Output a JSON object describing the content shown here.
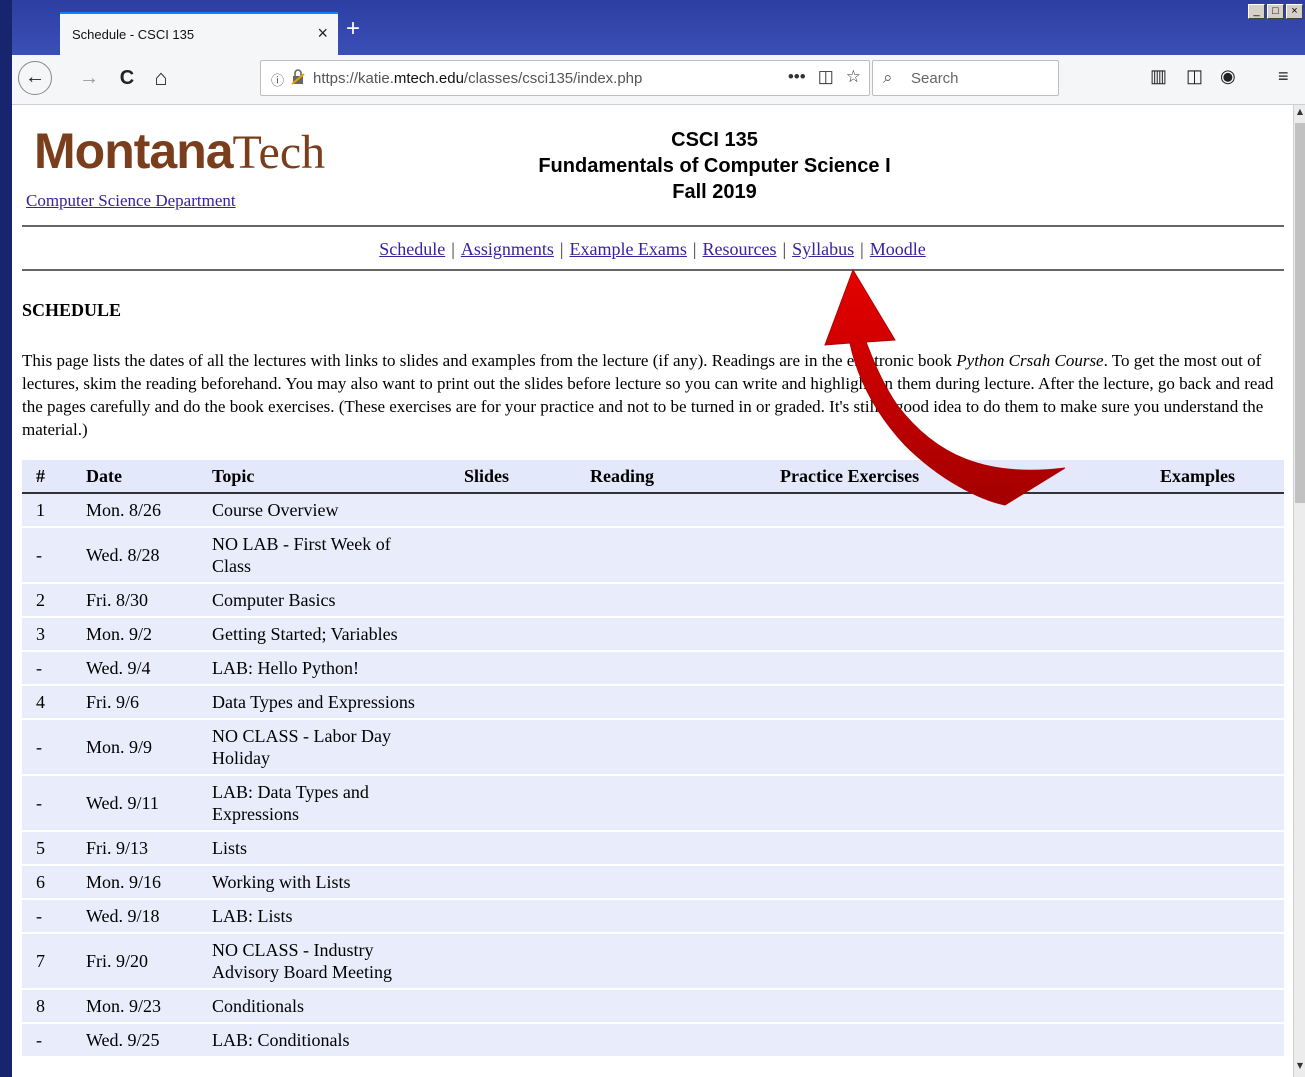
{
  "browser": {
    "tab_title": "Schedule - CSCI 135",
    "tab_close": "×",
    "new_tab": "+",
    "window_controls": [
      "_",
      "□",
      "×"
    ],
    "url_host_prefix": "https://katie.",
    "url_host": "mtech.edu",
    "url_path": "/classes/csci135/index.php",
    "search_placeholder": "Search",
    "nav": {
      "back": "←",
      "forward": "→",
      "reload": "C",
      "home": "⌂"
    },
    "url_actions": [
      "•••",
      "◫",
      "☆"
    ]
  },
  "header": {
    "logo_bold": "Montana",
    "logo_light": "Tech",
    "dept_link": "Computer Science Department",
    "course_code": "CSCI 135",
    "course_name": "Fundamentals of Computer Science I",
    "term": "Fall 2019"
  },
  "nav_links": [
    "Schedule",
    "Assignments",
    "Example Exams",
    "Resources",
    "Syllabus",
    "Moodle"
  ],
  "nav_separator": "|",
  "content": {
    "heading": "SCHEDULE",
    "intro_part1": "This page lists the dates of all the lectures with links to slides and examples from the lecture (if any). Readings are in the electronic book ",
    "intro_book": "Python Crsah Course",
    "intro_part2": ". To get the most out of lectures, skim the reading beforehand. You may also want to print out the slides before lecture so you can write and highlight on them during lecture. After the lecture, go back and read the pages carefully and do the book exercises. (These exercises are for your practice and not to be turned in or graded. It's still a good idea to do them to make sure you understand the material.)"
  },
  "table": {
    "columns": [
      "#",
      "Date",
      "Topic",
      "Slides",
      "Reading",
      "Practice Exercises",
      "Examples"
    ],
    "rows": [
      {
        "num": "1",
        "date": "Mon. 8/26",
        "topic": "Course Overview"
      },
      {
        "num": "-",
        "date": "Wed. 8/28",
        "topic": "NO LAB - First Week of Class"
      },
      {
        "num": "2",
        "date": "Fri. 8/30",
        "topic": "Computer Basics"
      },
      {
        "num": "3",
        "date": "Mon. 9/2",
        "topic": "Getting Started; Variables"
      },
      {
        "num": "-",
        "date": "Wed. 9/4",
        "topic": "LAB: Hello Python!"
      },
      {
        "num": "4",
        "date": "Fri. 9/6",
        "topic": "Data Types and Expressions"
      },
      {
        "num": "-",
        "date": "Mon. 9/9",
        "topic": "NO CLASS - Labor Day Holiday"
      },
      {
        "num": "-",
        "date": "Wed. 9/11",
        "topic": "LAB: Data Types and Expressions"
      },
      {
        "num": "5",
        "date": "Fri. 9/13",
        "topic": "Lists"
      },
      {
        "num": "6",
        "date": "Mon. 9/16",
        "topic": "Working with Lists"
      },
      {
        "num": "-",
        "date": "Wed. 9/18",
        "topic": "LAB: Lists"
      },
      {
        "num": "7",
        "date": "Fri. 9/20",
        "topic": "NO CLASS - Industry Advisory Board Meeting"
      },
      {
        "num": "8",
        "date": "Mon. 9/23",
        "topic": "Conditionals"
      },
      {
        "num": "-",
        "date": "Wed. 9/25",
        "topic": "LAB: Conditionals"
      }
    ]
  },
  "colors": {
    "link": "#3a20a0",
    "logo": "#7a3e1d",
    "table_row": "#e9ecfb",
    "arrow": "#cc0000"
  }
}
